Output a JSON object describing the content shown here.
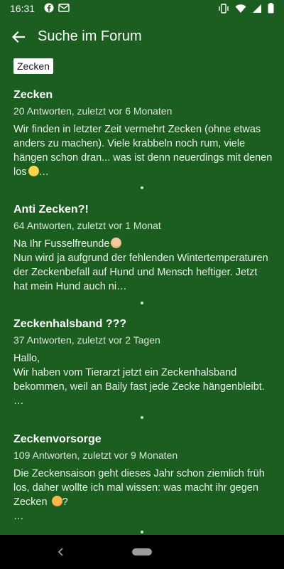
{
  "status_bar": {
    "time": "16:31",
    "left_icons": [
      "facebook-icon",
      "message-icon"
    ],
    "right_icons": [
      "vibrate-icon",
      "wifi-icon",
      "signal-icon",
      "battery-icon"
    ]
  },
  "app_bar": {
    "title": "Suche im Forum"
  },
  "search": {
    "chip_label": "Zecken"
  },
  "results": [
    {
      "title": "Zecken",
      "meta": "20 Antworten, zuletzt vor 6 Monaten",
      "excerpt": "Wir finden in letzter Zeit vermehrt Zecken (ohne etwas anders zu machen). Viele krabbeln noch rum, viele hängen schon dran... was ist denn neuerdings mit denen los",
      "excerpt_tail": "…",
      "emoji": "face-with-rolling-eyes"
    },
    {
      "title": "Anti Zecken?!",
      "meta": "64 Antworten, zuletzt vor 1 Monat",
      "excerpt_line1": "Na Ihr Fusselfreunde",
      "excerpt": "Nun wird ja aufgrund der fehlenden Wintertemperaturen der Zeckenbefall auf Hund und Mensch heftiger. Jetzt hat mein Hund auch ni…",
      "emoji": "person-tipping-hand"
    },
    {
      "title": "Zeckenhalsband ???",
      "meta": "37 Antworten, zuletzt vor 2 Tagen",
      "excerpt": "Hallo,\nWir haben vom Tierarzt jetzt ein Zeckenhalsband bekommen, weil an Baily fast jede Zecke hängenbleibt. …"
    },
    {
      "title": "Zeckenvorsorge",
      "meta": "109 Antworten, zuletzt vor 9 Monaten",
      "excerpt": "Die Zeckensaison geht dieses Jahr schon ziemlich früh los, daher wollte ich mal wissen: was macht ihr gegen Zecken",
      "excerpt_tail": "?\n…",
      "emoji": "cat-face"
    }
  ],
  "colors": {
    "background": "#1b5e20",
    "chip_bg": "#ffffff",
    "nav_bar": "#000000"
  }
}
